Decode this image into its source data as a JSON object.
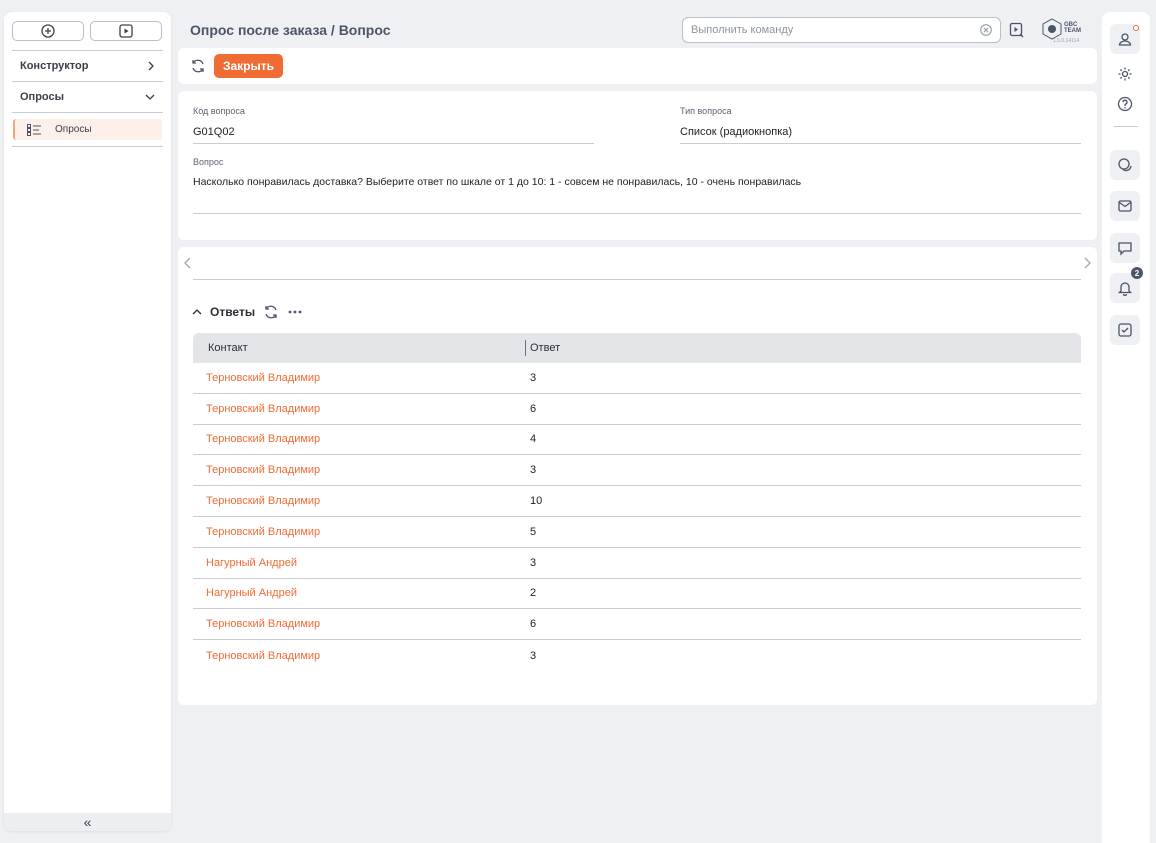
{
  "header": {
    "title": "Опрос после заказа / Вопрос",
    "command_placeholder": "Выполнить команду",
    "logo_line1": "GBC",
    "logo_line2": "TEAM",
    "version": "1.5.0.14114"
  },
  "sidebar": {
    "items": [
      {
        "label": "Конструктор",
        "expanded": false
      },
      {
        "label": "Опросы",
        "expanded": true
      }
    ],
    "sub_item": "Опросы",
    "collapse_glyph": "«"
  },
  "toolbar": {
    "close_label": "Закрыть"
  },
  "form": {
    "code_label": "Код вопроса",
    "code_value": "G01Q02",
    "type_label": "Тип вопроса",
    "type_value": "Список (радиокнопка)",
    "question_label": "Вопрос",
    "question_value": "Насколько понравилась доставка?  Выберите ответ по шкале от 1 до 10:  1 - совсем не понравилась, 10 - очень понравилась"
  },
  "answers": {
    "section_title": "Ответы",
    "columns": [
      "Контакт",
      "Ответ"
    ],
    "rows": [
      {
        "contact": "Терновский Владимир",
        "answer": "3"
      },
      {
        "contact": "Терновский Владимир",
        "answer": "6"
      },
      {
        "contact": "Терновский Владимир",
        "answer": "4"
      },
      {
        "contact": "Терновский Владимир",
        "answer": "3"
      },
      {
        "contact": "Терновский Владимир",
        "answer": "10"
      },
      {
        "contact": "Терновский Владимир",
        "answer": "5"
      },
      {
        "contact": "Нагурный Андрей",
        "answer": "3"
      },
      {
        "contact": "Нагурный Андрей",
        "answer": "2"
      },
      {
        "contact": "Терновский Владимир",
        "answer": "6"
      },
      {
        "contact": "Терновский Владимир",
        "answer": "3"
      }
    ]
  },
  "rail": {
    "notification_count": "2"
  },
  "colors": {
    "accent": "#f06c35",
    "title": "#4b5568",
    "background": "#eef0f4"
  }
}
